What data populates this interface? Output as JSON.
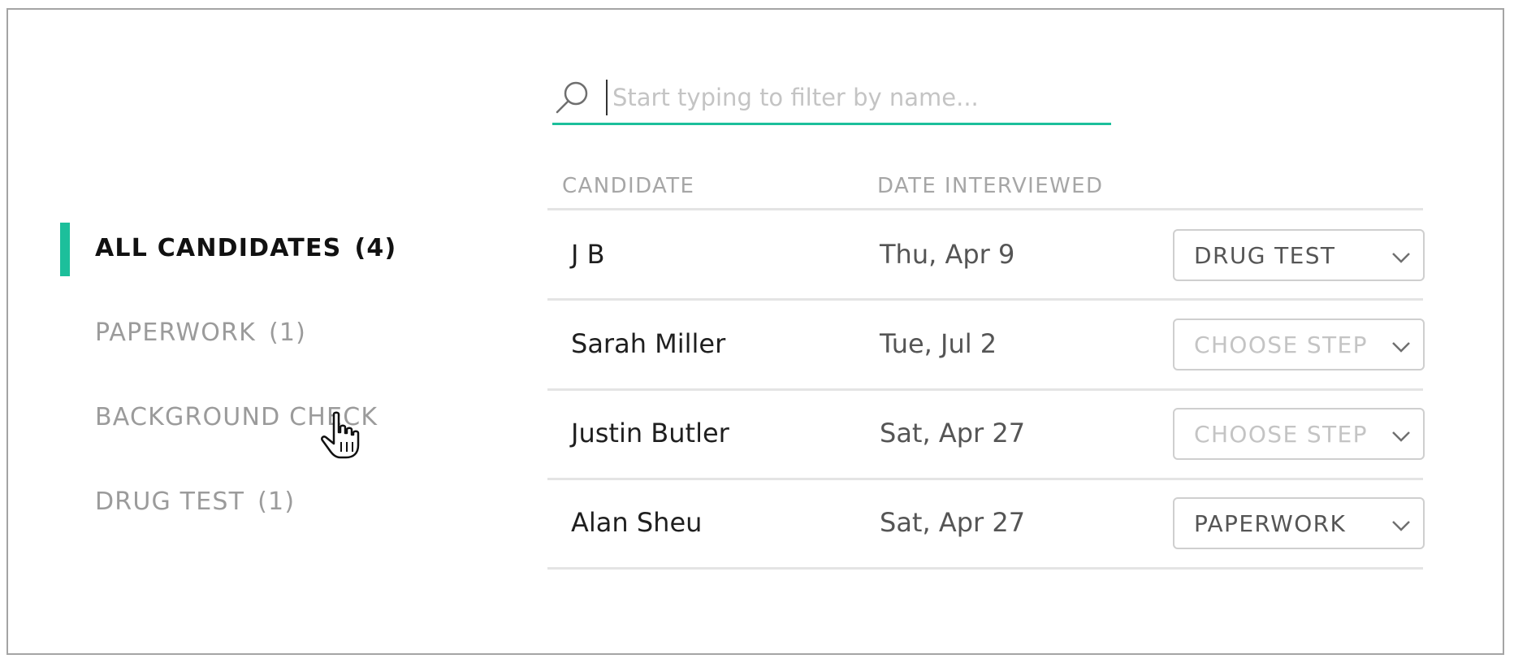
{
  "sidebar": {
    "items": [
      {
        "label": "ALL CANDIDATES",
        "count": "(4)"
      },
      {
        "label": "PAPERWORK",
        "count": "(1)"
      },
      {
        "label": "BACKGROUND CHECK",
        "count": ""
      },
      {
        "label": "DRUG TEST",
        "count": "(1)"
      }
    ]
  },
  "search": {
    "placeholder": "Start typing to filter by name...",
    "value": ""
  },
  "table": {
    "headers": [
      "CANDIDATE",
      "DATE INTERVIEWED"
    ],
    "rows": [
      {
        "name": "J B",
        "date": "Thu, Apr 9",
        "step": "DRUG TEST"
      },
      {
        "name": "Sarah Miller",
        "date": "Tue, Jul 2",
        "step": "CHOOSE STEP"
      },
      {
        "name": "Justin Butler",
        "date": "Sat, Apr 27",
        "step": "CHOOSE STEP"
      },
      {
        "name": "Alan Sheu",
        "date": "Sat, Apr 27",
        "step": "PAPERWORK"
      }
    ]
  },
  "colors": {
    "accent": "#1cbf9b",
    "muted_text": "#9b9b9b",
    "border": "#a4a4a4"
  },
  "icons": [
    "search-icon",
    "chevron-down-icon",
    "hand-pointer-icon"
  ]
}
